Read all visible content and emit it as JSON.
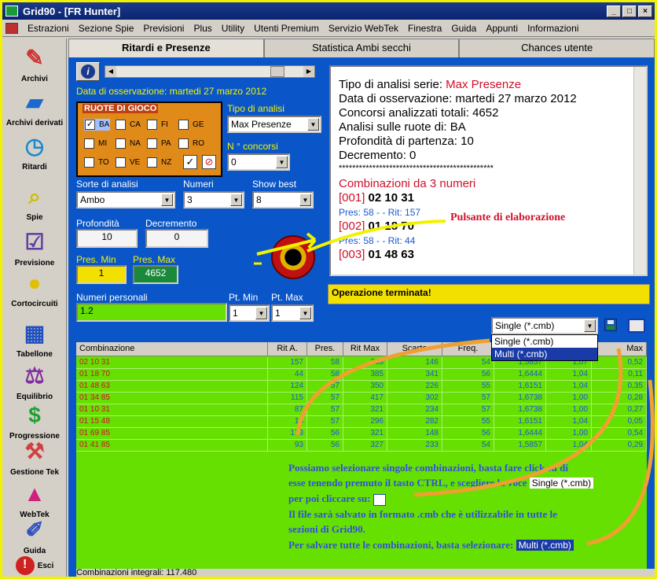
{
  "window": {
    "title": "Grid90 - [FR Hunter]"
  },
  "menu": [
    "Estrazioni",
    "Sezione Spie",
    "Previsioni",
    "Plus",
    "Utility",
    "Utenti Premium",
    "Servizio WebTek",
    "Finestra",
    "Guida",
    "Appunti",
    "Informazioni"
  ],
  "sidebar": [
    "Archivi",
    "Archivi derivati",
    "Ritardi",
    "Spie",
    "Previsione",
    "Cortocircuiti",
    "Tabellone",
    "Equilibrio",
    "Progressione",
    "Gestione Tek",
    "WebTek",
    "Guida",
    "Esci"
  ],
  "tabs": [
    "Ritardi e Presenze",
    "Statistica Ambi secchi",
    "Chances utente"
  ],
  "panel": {
    "date_label": "Data di osservazione:  martedi 27 marzo 2012",
    "ruote_title": "RUOTE DI GIOCO",
    "ruote": [
      {
        "name": "BA",
        "checked": "✓"
      },
      {
        "name": "CA",
        "checked": ""
      },
      {
        "name": "FI",
        "checked": ""
      },
      {
        "name": "GE",
        "checked": ""
      },
      {
        "name": "MI",
        "checked": ""
      },
      {
        "name": "NA",
        "checked": ""
      },
      {
        "name": "PA",
        "checked": ""
      },
      {
        "name": "RO",
        "checked": ""
      },
      {
        "name": "TO",
        "checked": ""
      },
      {
        "name": "VE",
        "checked": ""
      },
      {
        "name": "NZ",
        "checked": ""
      }
    ],
    "tipo_label": "Tipo di analisi",
    "tipo_value": "Max Presenze",
    "concorsi_label": "N ° concorsi",
    "concorsi_value": "0",
    "sorte_label": "Sorte di analisi",
    "sorte_value": "Ambo",
    "numeri_label": "Numeri",
    "numeri_value": "3",
    "show_label": "Show best",
    "show_value": "8",
    "profondita_label": "Profondità",
    "profondita_value": "10",
    "decremento_label": "Decremento",
    "decremento_value": "0",
    "presmin_label": "Pres. Min",
    "presmin_value": "1",
    "presmax_label": "Pres. Max",
    "presmax_value": "4652",
    "personali_label": "Numeri personali",
    "personali_value": "1.2",
    "ptmin_label": "Pt. Min",
    "ptmin_value": "1",
    "ptmax_label": "Pt. Max",
    "ptmax_value": "1"
  },
  "output": {
    "lines": [
      {
        "prefix": "Tipo di analisi serie: ",
        "value": "Max Presenze"
      },
      {
        "prefix": "Data di osservazione: martedi 27 marzo 2012",
        "value": ""
      },
      {
        "prefix": "Concorsi analizzati totali: 4652",
        "value": ""
      },
      {
        "prefix": "Analisi sulle ruote di: BA",
        "value": ""
      },
      {
        "prefix": "Profondità di partenza: 10",
        "value": ""
      },
      {
        "prefix": "Decremento: 0",
        "value": ""
      }
    ],
    "stars": "**********************************************",
    "combo_title": "Combinazioni da 3 numeri",
    "combos": [
      {
        "idx": "[001]",
        "nums": "02 10 31",
        "stats": "Pres: 58 - - Rit: 157"
      },
      {
        "idx": "[002]",
        "nums": "01 18 70",
        "stats": "Pres: 58 - - Rit: 44"
      },
      {
        "idx": "[003]",
        "nums": "01 48 63",
        "stats": ""
      }
    ]
  },
  "annotation_button": "Pulsante di elaborazione",
  "status": "Operazione terminata!",
  "export": {
    "selected": "Single (*.cmb)",
    "options": [
      "Single (*.cmb)",
      "Multi (*.cmb)"
    ]
  },
  "grid": {
    "headers": [
      "Combinazione",
      "Rit A.",
      "Pres.",
      "Rit Max",
      "Scarto",
      "Freq.",
      "",
      "",
      "Max"
    ],
    "rows": [
      [
        "02 10 31",
        "157",
        "58",
        "303",
        "146",
        "54",
        "1,5857",
        "1,07",
        "0,52"
      ],
      [
        "01 18 70",
        "44",
        "58",
        "385",
        "341",
        "56",
        "1,6444",
        "1,04",
        "0,11"
      ],
      [
        "01 48 63",
        "124",
        "57",
        "350",
        "226",
        "55",
        "1,6151",
        "1,04",
        "0,35"
      ],
      [
        "01 34 85",
        "115",
        "57",
        "417",
        "302",
        "57",
        "1,6738",
        "1,00",
        "0,28"
      ],
      [
        "01 10 31",
        "87",
        "57",
        "321",
        "234",
        "57",
        "1,6738",
        "1,00",
        "0,27"
      ],
      [
        "01 15 48",
        "16",
        "57",
        "296",
        "282",
        "55",
        "1,6151",
        "1,04",
        "0,05"
      ],
      [
        "01 69 85",
        "173",
        "56",
        "321",
        "148",
        "56",
        "1,6444",
        "1,00",
        "0,54"
      ],
      [
        "01 41 85",
        "93",
        "56",
        "327",
        "233",
        "54",
        "1,5857",
        "1,04",
        "0,29"
      ]
    ]
  },
  "notes": {
    "l1": "Possiamo selezionare singole combinazioni, basta fare click su di",
    "l2": "esse tenendo premuto il tasto CTRL, e scegliere la voce",
    "chip1": "Single (*.cmb)",
    "l3": "per poi cliccare su:",
    "l4": "Il file sarà salvato in formato .cmb che è utilizzabile in tutte le",
    "l5": "sezioni di Grid90.",
    "l6": "Per salvare tutte le combinazioni, basta selezionare:",
    "chip2": "Multi (*.cmb)"
  },
  "footer": "Combinazioni integrali: 117.480"
}
